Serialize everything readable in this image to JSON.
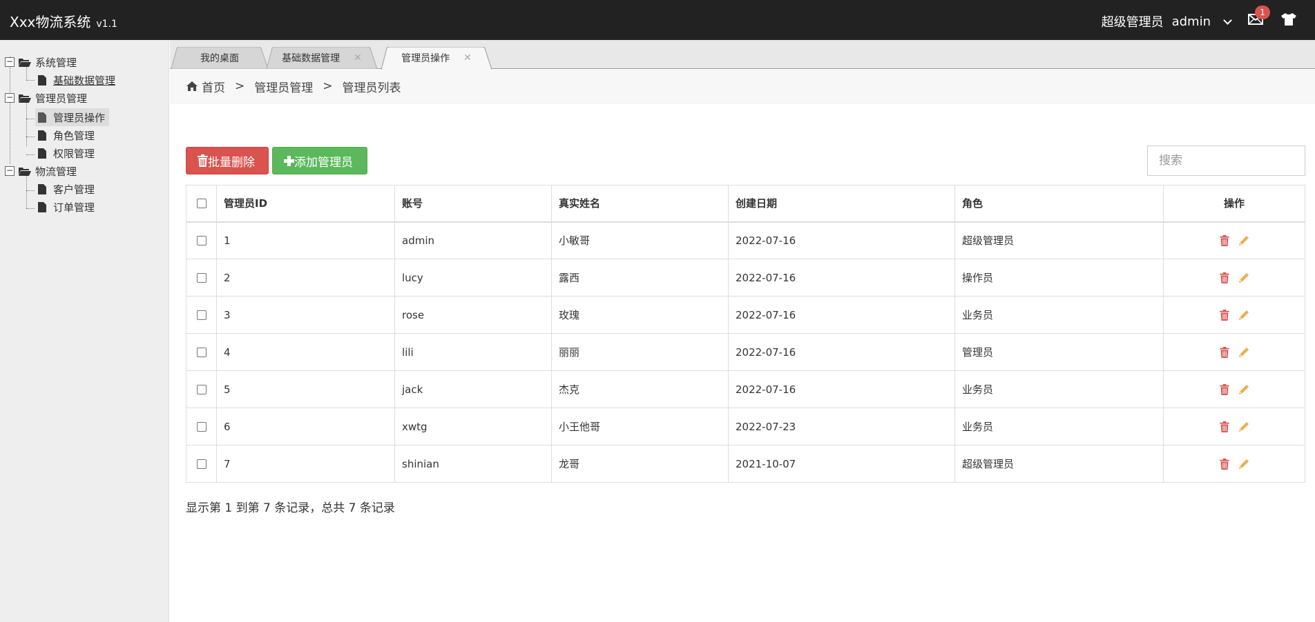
{
  "header": {
    "app_name": "Xxx物流系统",
    "version": "v1.1",
    "role": "超级管理员",
    "user": "admin",
    "mail_count": "1"
  },
  "sidebar": {
    "groups": [
      {
        "label": "系统管理",
        "items": [
          {
            "label": "基础数据管理"
          }
        ]
      },
      {
        "label": "管理员管理",
        "items": [
          {
            "label": "管理员操作"
          },
          {
            "label": "角色管理"
          },
          {
            "label": "权限管理"
          }
        ]
      },
      {
        "label": "物流管理",
        "items": [
          {
            "label": "客户管理"
          },
          {
            "label": "订单管理"
          }
        ]
      }
    ]
  },
  "tabs": [
    {
      "label": "我的桌面"
    },
    {
      "label": "基础数据管理"
    },
    {
      "label": "管理员操作"
    }
  ],
  "breadcrumb": {
    "home": "首页",
    "level1": "管理员管理",
    "level2": "管理员列表",
    "sep": ">"
  },
  "toolbar": {
    "batch_delete": "批量删除",
    "add_admin": "添加管理员",
    "search_placeholder": "搜索"
  },
  "table": {
    "headers": [
      "管理员ID",
      "账号",
      "真实姓名",
      "创建日期",
      "角色",
      "操作"
    ],
    "rows": [
      {
        "id": "1",
        "account": "admin",
        "name": "小敏哥",
        "date": "2022-07-16",
        "role": "超级管理员"
      },
      {
        "id": "2",
        "account": "lucy",
        "name": "露西",
        "date": "2022-07-16",
        "role": "操作员"
      },
      {
        "id": "3",
        "account": "rose",
        "name": "玫瑰",
        "date": "2022-07-16",
        "role": "业务员"
      },
      {
        "id": "4",
        "account": "lili",
        "name": "丽丽",
        "date": "2022-07-16",
        "role": "管理员"
      },
      {
        "id": "5",
        "account": "jack",
        "name": "杰克",
        "date": "2022-07-16",
        "role": "业务员"
      },
      {
        "id": "6",
        "account": "xwtg",
        "name": "小王他哥",
        "date": "2022-07-23",
        "role": "业务员"
      },
      {
        "id": "7",
        "account": "shinian",
        "name": "龙哥",
        "date": "2021-10-07",
        "role": "超级管理员"
      }
    ]
  },
  "footer": {
    "info": "显示第 1 到第 7 条记录，总共 7 条记录"
  },
  "colors": {
    "header_bg": "#222222",
    "danger": "#d9534f",
    "success": "#5cb85c",
    "edit": "#f0ad4e"
  }
}
